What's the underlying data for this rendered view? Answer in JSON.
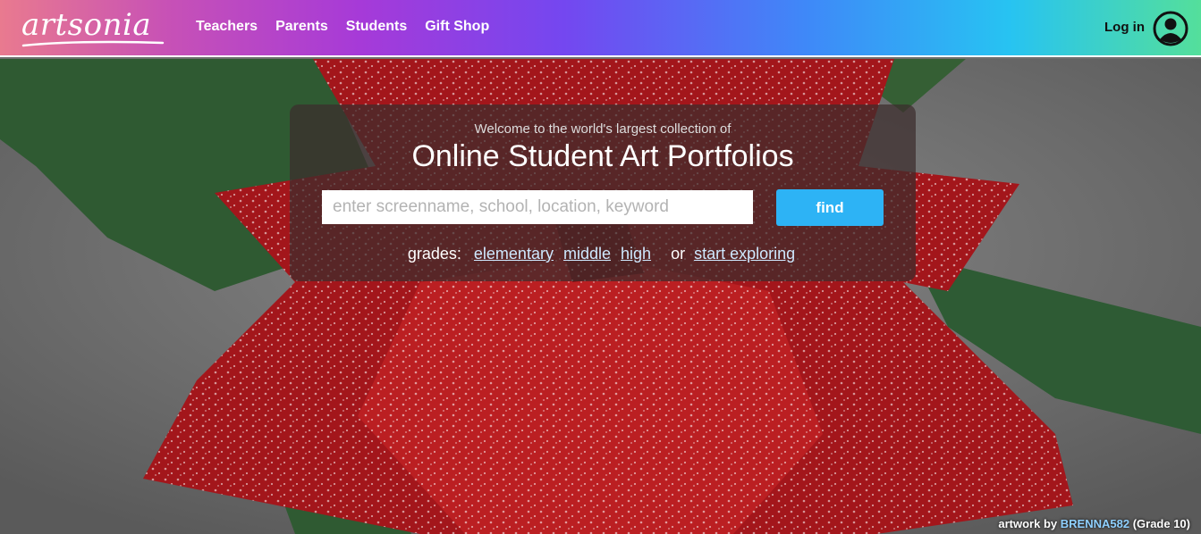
{
  "brand": {
    "logo_text": "artsonia"
  },
  "nav": {
    "items": [
      {
        "label": "Teachers"
      },
      {
        "label": "Parents"
      },
      {
        "label": "Students"
      },
      {
        "label": "Gift Shop"
      }
    ]
  },
  "account": {
    "login_label": "Log in",
    "icon": "user-circle-icon"
  },
  "hero": {
    "welcome": "Welcome to the world's largest collection of",
    "headline": "Online Student Art Portfolios",
    "search": {
      "placeholder": "enter screenname, school, location, keyword",
      "value": ""
    },
    "find_label": "find",
    "grades_label": "grades:",
    "grades": {
      "elementary": "elementary",
      "middle": "middle",
      "high": "high"
    },
    "or_label": "or",
    "explore_label": "start exploring"
  },
  "credit": {
    "prefix": "artwork by",
    "artist": "BRENNA582",
    "grade": "(Grade 10)"
  },
  "colors": {
    "find_button": "#2db3f5",
    "link": "#cfe9ff",
    "artist_link": "#8fd0ff"
  }
}
